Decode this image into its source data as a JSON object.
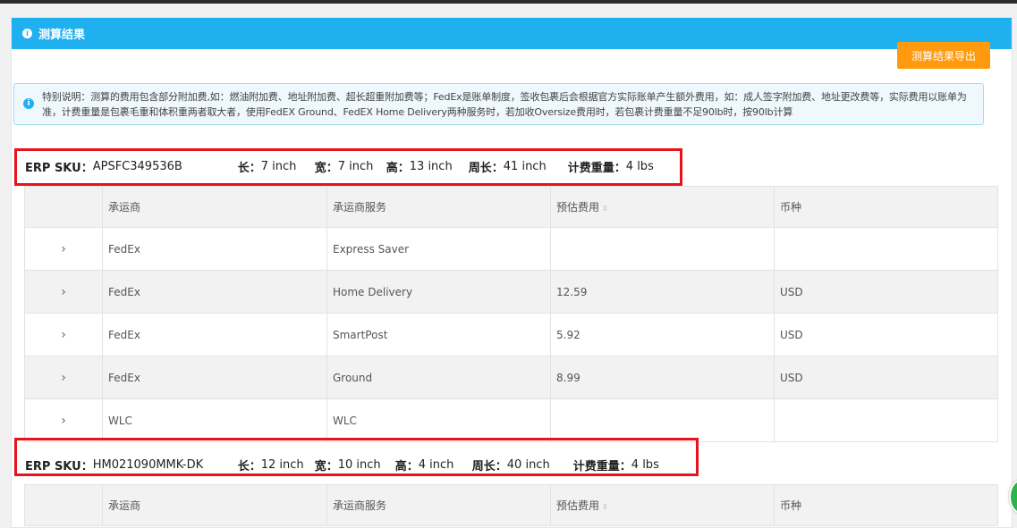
{
  "panel": {
    "title": "测算结果"
  },
  "toolbar": {
    "export_label": "测算结果导出"
  },
  "notice": {
    "text": "特别说明：测算的费用包含部分附加费,如：燃油附加费、地址附加费、超长超重附加费等；FedEx是账单制度，签收包裹后会根据官方实际账单产生额外费用，如：成人签字附加费、地址更改费等，实际费用以账单为准，计费重量是包裹毛重和体积重两者取大者，使用FedEX Ground、FedEX Home Delivery两种服务时，若加收Oversize费用时，若包裹计费重量不足90lb时，按90lb计算"
  },
  "labels": {
    "sku": "ERP SKU：",
    "length": "长：",
    "width": "宽：",
    "height": "高：",
    "girth": "周长：",
    "weight": "计费重量："
  },
  "table_headers": {
    "carrier": "承运商",
    "service": "承运商服务",
    "fee": "预估费用",
    "currency": "币种"
  },
  "products": [
    {
      "sku": "APSFC349536B",
      "length": "7 inch",
      "width": "7 inch",
      "height": "13 inch",
      "girth": "41 inch",
      "weight": "4 lbs",
      "rows": [
        {
          "carrier": "FedEx",
          "service": "Express Saver",
          "fee": "",
          "currency": ""
        },
        {
          "carrier": "FedEx",
          "service": "Home Delivery",
          "fee": "12.59",
          "currency": "USD"
        },
        {
          "carrier": "FedEx",
          "service": "SmartPost",
          "fee": "5.92",
          "currency": "USD"
        },
        {
          "carrier": "FedEx",
          "service": "Ground",
          "fee": "8.99",
          "currency": "USD"
        },
        {
          "carrier": "WLC",
          "service": "WLC",
          "fee": "",
          "currency": ""
        }
      ]
    },
    {
      "sku": "HM021090MMK-DK",
      "length": "12 inch",
      "width": "10 inch",
      "height": "4 inch",
      "girth": "40 inch",
      "weight": "4 lbs"
    }
  ],
  "icons": {
    "header": "info-circle-icon",
    "notice": "info-icon",
    "expand": "chevron-right-icon",
    "sort": "sort-icon"
  },
  "colors": {
    "header": "#1fb0ef",
    "export": "#ff9a0e",
    "highlight": "#e8141c"
  }
}
